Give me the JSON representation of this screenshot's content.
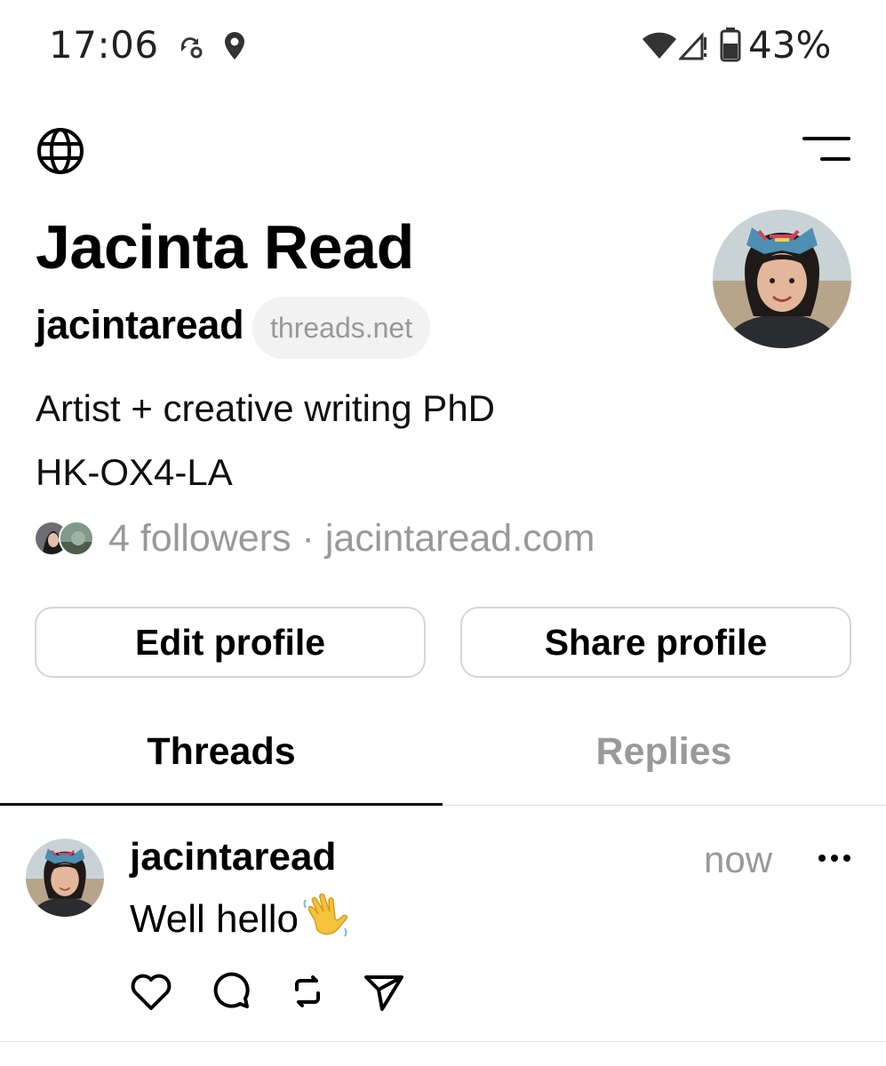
{
  "status_bar": {
    "time": "17:06",
    "battery_percent": "43%",
    "icons": [
      "sync-settings-icon",
      "location-pin-icon",
      "wifi-icon",
      "cell-signal-icon",
      "battery-icon"
    ]
  },
  "top_nav": {
    "left_icon": "globe-icon",
    "right_icon": "menu-icon"
  },
  "profile": {
    "name": "Jacinta Read",
    "handle": "jacintaread",
    "domain_badge": "threads.net",
    "bio_lines": [
      "Artist + creative writing PhD",
      "HK-OX4-LA"
    ],
    "followers_text": "4 followers",
    "separator": "·",
    "website": "jacintaread.com"
  },
  "actions": {
    "edit_label": "Edit profile",
    "share_label": "Share profile"
  },
  "tabs": [
    {
      "label": "Threads",
      "active": true
    },
    {
      "label": "Replies",
      "active": false
    }
  ],
  "post": {
    "username": "jacintaread",
    "time": "now",
    "text": "Well hello",
    "emoji": "waving-hand-emoji",
    "action_icons": [
      "heart-icon",
      "comment-icon",
      "repost-icon",
      "share-icon"
    ]
  },
  "colors": {
    "text": "#000000",
    "muted": "#999999",
    "border": "#d6d6d6",
    "pill_bg": "#f2f2f2"
  }
}
